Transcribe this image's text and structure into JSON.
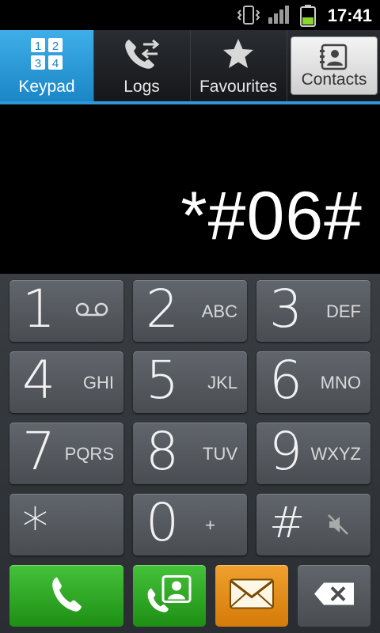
{
  "status": {
    "time": "17:41",
    "icons": [
      "vibrate-icon",
      "signal-icon",
      "battery-icon"
    ]
  },
  "tabs": [
    {
      "label": "Keypad",
      "icon": "keypad-grid-icon",
      "active": true
    },
    {
      "label": "Logs",
      "icon": "call-logs-icon",
      "active": false
    },
    {
      "label": "Favourites",
      "icon": "star-icon",
      "active": false
    },
    {
      "label": "Contacts",
      "icon": "contacts-book-icon",
      "active": false
    }
  ],
  "display": {
    "number": "*#06#"
  },
  "keypad": {
    "keys": [
      {
        "digit": "1",
        "letters": "",
        "icon": "voicemail-icon"
      },
      {
        "digit": "2",
        "letters": "ABC"
      },
      {
        "digit": "3",
        "letters": "DEF"
      },
      {
        "digit": "4",
        "letters": "GHI"
      },
      {
        "digit": "5",
        "letters": "JKL"
      },
      {
        "digit": "6",
        "letters": "MNO"
      },
      {
        "digit": "7",
        "letters": "PQRS"
      },
      {
        "digit": "8",
        "letters": "TUV"
      },
      {
        "digit": "9",
        "letters": "WXYZ"
      },
      {
        "digit": "*",
        "letters": ""
      },
      {
        "digit": "0",
        "letters": "+"
      },
      {
        "digit": "#",
        "letters": "",
        "icon": "mute-speaker-icon"
      }
    ]
  },
  "actions": {
    "call": "phone-call-icon",
    "video_call": "video-call-icon",
    "message": "envelope-icon",
    "delete": "backspace-icon"
  },
  "colors": {
    "active_tab": "#2f97d6",
    "call_green": "#2aa51f",
    "message_orange": "#e68d14",
    "key_gray": "#55595e"
  }
}
